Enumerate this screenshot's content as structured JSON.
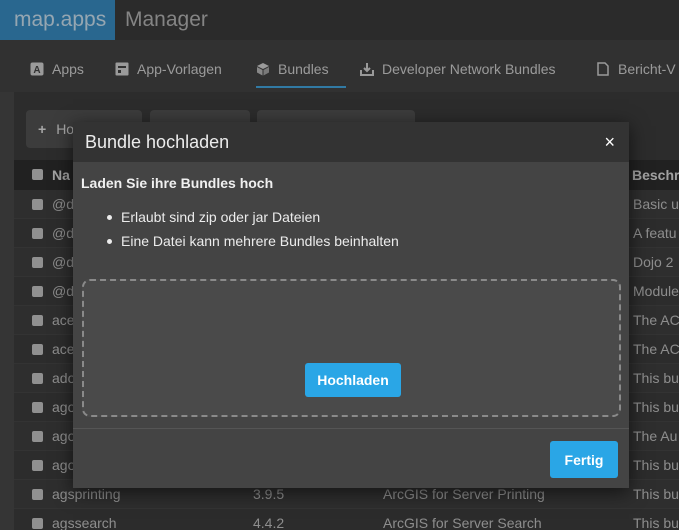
{
  "header": {
    "brand": "map.apps",
    "title": "Manager"
  },
  "tabs": [
    {
      "label": "Apps",
      "icon": "app-icon",
      "active": false
    },
    {
      "label": "App-Vorlagen",
      "icon": "template-icon",
      "active": false
    },
    {
      "label": "Bundles",
      "icon": "box-icon",
      "active": true
    },
    {
      "label": "Developer Network Bundles",
      "icon": "download-icon",
      "active": false
    },
    {
      "label": "Bericht-V",
      "icon": "file-icon",
      "active": false
    }
  ],
  "toolbar": {
    "add_label": "Ho"
  },
  "table": {
    "columns": {
      "name": "Na",
      "description": "Beschre"
    },
    "rows": [
      {
        "name": "@d",
        "version": "",
        "title": "",
        "description": "Basic u"
      },
      {
        "name": "@d",
        "version": "",
        "title": "",
        "description": "A featu"
      },
      {
        "name": "@d",
        "version": "",
        "title": "",
        "description": "Dojo 2"
      },
      {
        "name": "@d",
        "version": "",
        "title": "",
        "description": "Module"
      },
      {
        "name": "ace",
        "version": "",
        "title": "",
        "description": "The AC"
      },
      {
        "name": "ace",
        "version": "",
        "title": "",
        "description": "The AC"
      },
      {
        "name": "ado",
        "version": "",
        "title": "",
        "description": "This bu"
      },
      {
        "name": "ago",
        "version": "",
        "title": "",
        "description": "This bu"
      },
      {
        "name": "ago",
        "version": "",
        "title": "",
        "description": "The Au"
      },
      {
        "name": "ago",
        "version": "",
        "title": "",
        "description": "This bu"
      },
      {
        "name": "agsprinting",
        "version": "3.9.5",
        "title": "ArcGIS for Server Printing",
        "description": "This bu"
      },
      {
        "name": "agssearch",
        "version": "4.4.2",
        "title": "ArcGIS for Server Search",
        "description": "This bu"
      }
    ]
  },
  "dialog": {
    "title": "Bundle hochladen",
    "close": "×",
    "heading": "Laden Sie ihre Bundles hoch",
    "bullets": [
      "Erlaubt sind zip oder jar Dateien",
      "Eine Datei kann mehrere Bundles beinhalten"
    ],
    "upload_label": "Hochladen",
    "done_label": "Fertig"
  },
  "colors": {
    "brand": "#3a8fc7",
    "accent": "#2aa6e6"
  }
}
